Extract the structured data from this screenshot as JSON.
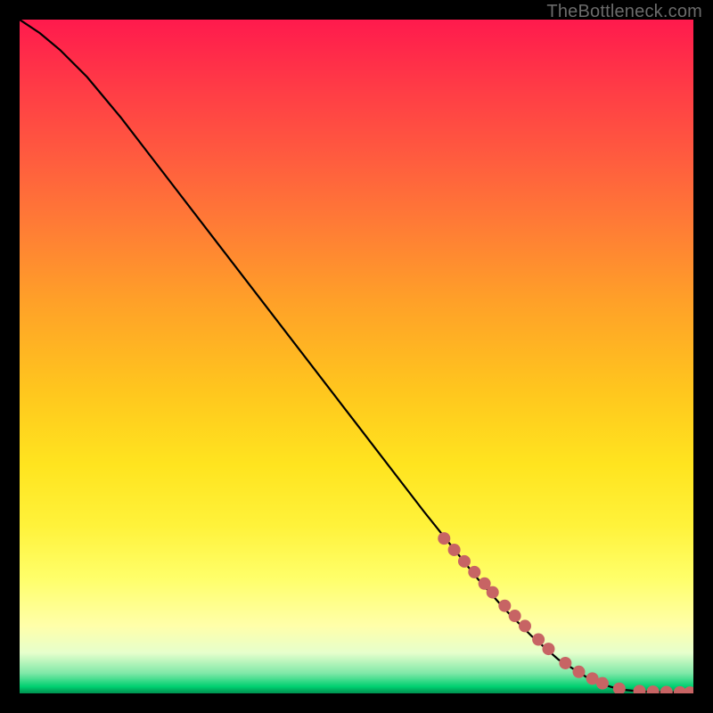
{
  "attribution": "TheBottleneck.com",
  "chart_data": {
    "type": "line",
    "title": "",
    "xlabel": "",
    "ylabel": "",
    "xlim": [
      0,
      100
    ],
    "ylim": [
      0,
      100
    ],
    "series": [
      {
        "name": "bottleneck-curve",
        "x": [
          0,
          3,
          6,
          10,
          15,
          20,
          30,
          40,
          50,
          60,
          64,
          68,
          72,
          76,
          80,
          84,
          87,
          89,
          92,
          95,
          98,
          100
        ],
        "y": [
          100,
          98,
          95.5,
          91.5,
          85.5,
          79,
          66,
          53,
          40,
          27,
          22,
          17,
          12.5,
          8.5,
          5,
          2.5,
          1.2,
          0.6,
          0.3,
          0.2,
          0.15,
          0.1
        ]
      }
    ],
    "markers": {
      "name": "highlighted-points",
      "x": [
        63,
        64.5,
        66,
        67.5,
        69,
        70.2,
        72,
        73.5,
        75,
        77,
        78.5,
        81,
        83,
        85,
        86.5,
        89,
        92,
        94,
        96,
        98,
        99.5
      ],
      "y": [
        23,
        21.3,
        19.6,
        18,
        16.3,
        15,
        13,
        11.5,
        10,
        8,
        6.6,
        4.5,
        3.2,
        2.2,
        1.5,
        0.7,
        0.35,
        0.25,
        0.2,
        0.15,
        0.12
      ]
    },
    "background_gradient": {
      "top_color": "#ff1a4d",
      "mid_color": "#ffe41f",
      "bottom_color": "#009050"
    }
  }
}
